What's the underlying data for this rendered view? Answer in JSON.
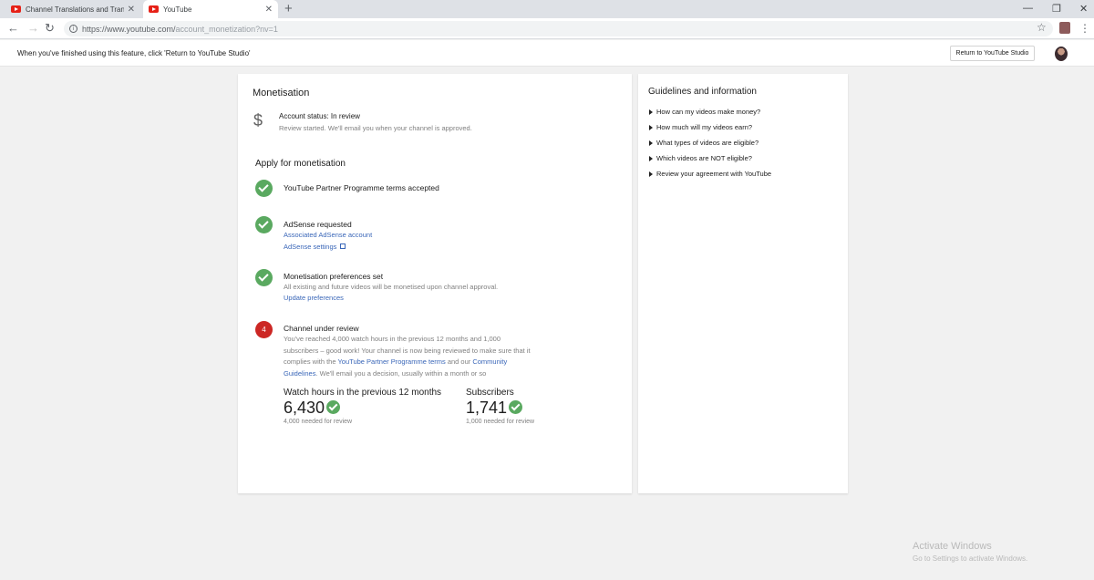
{
  "browser": {
    "tabs": [
      {
        "title": "Channel Translations and Transcr"
      },
      {
        "title": "YouTube"
      }
    ],
    "url_base": "https://www.youtube.com/",
    "url_rest": "account_monetization?nv=1"
  },
  "notice": {
    "text": "When you've finished using this feature, click 'Return to YouTube Studio'",
    "return_button": "Return to YouTube Studio"
  },
  "main": {
    "title": "Monetisation",
    "account_status": {
      "title": "Account status: In review",
      "subtitle": "Review started. We'll email you when your channel is approved."
    },
    "apply_heading": "Apply for monetisation",
    "steps": [
      {
        "title": "YouTube Partner Programme terms accepted"
      },
      {
        "title": "AdSense requested",
        "links": [
          "Associated AdSense account",
          "AdSense settings"
        ]
      },
      {
        "title": "Monetisation preferences set",
        "desc": "All existing and future videos will be monetised upon channel approval.",
        "link": "Update preferences"
      },
      {
        "number": "4",
        "title": "Channel under review",
        "desc_line1": "You've reached 4,000 watch hours in the previous 12 months and 1,000",
        "desc_line2": "subscribers – good work! Your channel is now being reviewed to make sure that it",
        "desc_line3_pre": "complies with the ",
        "desc_line3_link": "YouTube Partner Programme terms",
        "desc_line3_mid": " and our ",
        "desc_line3_link2": "Community",
        "desc_line4_link": "Guidelines",
        "desc_line4_post": ". We'll email you a decision, usually within a month or so"
      }
    ],
    "metrics": [
      {
        "label": "Watch hours in the previous 12 months",
        "value": "6,430",
        "sub": "4,000 needed for review"
      },
      {
        "label": "Subscribers",
        "value": "1,741",
        "sub": "1,000 needed for review"
      }
    ]
  },
  "side": {
    "title": "Guidelines and information",
    "items": [
      "How can my videos make money?",
      "How much will my videos earn?",
      "What types of videos are eligible?",
      "Which videos are NOT eligible?",
      "Review your agreement with YouTube"
    ]
  },
  "watermark": {
    "title": "Activate Windows",
    "subtitle": "Go to Settings to activate Windows."
  }
}
